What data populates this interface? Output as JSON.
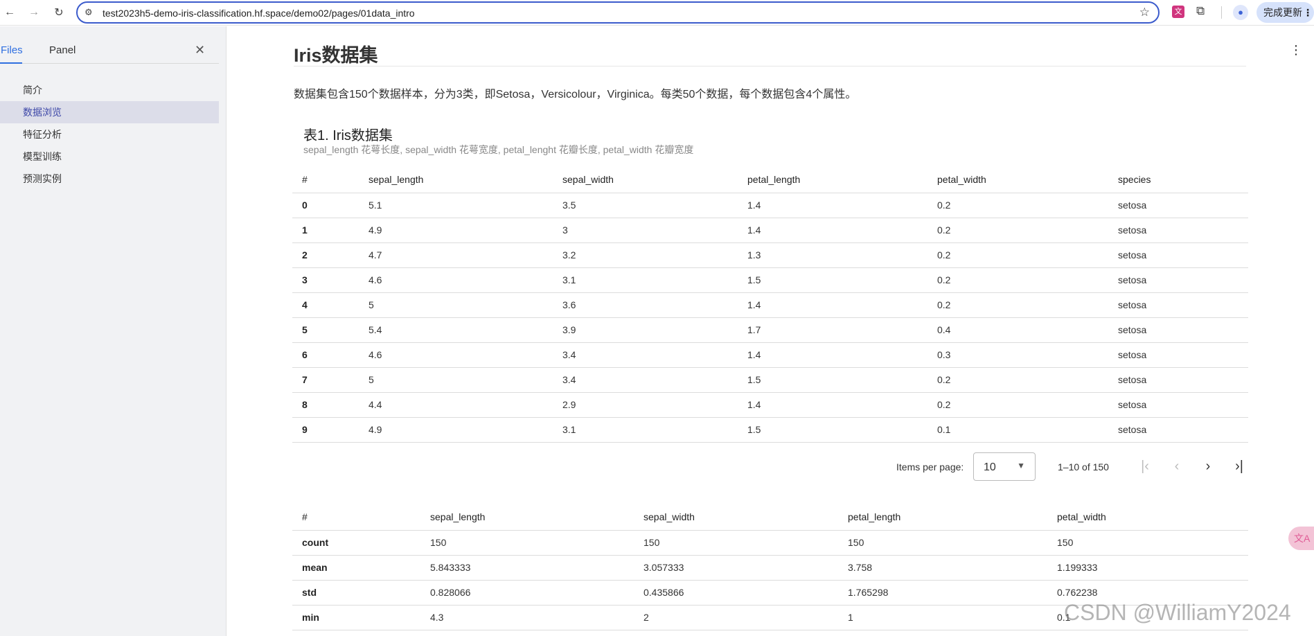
{
  "browser": {
    "url": "test2023h5-demo-iris-classification.hf.space/demo02/pages/01data_intro",
    "ext_label": "文",
    "update_button": "完成更新"
  },
  "sidebar": {
    "tabs": [
      {
        "label": "Files"
      },
      {
        "label": "Panel"
      }
    ],
    "items": [
      {
        "label": "简介"
      },
      {
        "label": "数据浏览"
      },
      {
        "label": "特征分析"
      },
      {
        "label": "模型训练"
      },
      {
        "label": "预测实例"
      }
    ]
  },
  "main": {
    "title": "Iris数据集",
    "intro": "数据集包含150个数据样本，分为3类，即Setosa，Versicolour，Virginica。每类50个数据，每个数据包含4个属性。",
    "caption": "表1. Iris数据集",
    "subcaption": "sepal_length 花萼长度, sepal_width 花萼宽度, petal_lenght 花瓣长度, petal_width 花瓣宽度",
    "table1": {
      "headers": [
        "#",
        "sepal_length",
        "sepal_width",
        "petal_length",
        "petal_width",
        "species"
      ],
      "rows": [
        [
          "0",
          "5.1",
          "3.5",
          "1.4",
          "0.2",
          "setosa"
        ],
        [
          "1",
          "4.9",
          "3",
          "1.4",
          "0.2",
          "setosa"
        ],
        [
          "2",
          "4.7",
          "3.2",
          "1.3",
          "0.2",
          "setosa"
        ],
        [
          "3",
          "4.6",
          "3.1",
          "1.5",
          "0.2",
          "setosa"
        ],
        [
          "4",
          "5",
          "3.6",
          "1.4",
          "0.2",
          "setosa"
        ],
        [
          "5",
          "5.4",
          "3.9",
          "1.7",
          "0.4",
          "setosa"
        ],
        [
          "6",
          "4.6",
          "3.4",
          "1.4",
          "0.3",
          "setosa"
        ],
        [
          "7",
          "5",
          "3.4",
          "1.5",
          "0.2",
          "setosa"
        ],
        [
          "8",
          "4.4",
          "2.9",
          "1.4",
          "0.2",
          "setosa"
        ],
        [
          "9",
          "4.9",
          "3.1",
          "1.5",
          "0.1",
          "setosa"
        ]
      ]
    },
    "paginator": {
      "items_per_page_label": "Items per page:",
      "items_per_page_value": "10",
      "range": "1–10 of 150"
    },
    "table2": {
      "headers": [
        "#",
        "sepal_length",
        "sepal_width",
        "petal_length",
        "petal_width"
      ],
      "rows": [
        [
          "count",
          "150",
          "150",
          "150",
          "150"
        ],
        [
          "mean",
          "5.843333",
          "3.057333",
          "3.758",
          "1.199333"
        ],
        [
          "std",
          "0.828066",
          "0.435866",
          "1.765298",
          "0.762238"
        ],
        [
          "min",
          "4.3",
          "2",
          "1",
          "0.1"
        ]
      ]
    }
  },
  "float_button": "文A",
  "watermark": "CSDN @WilliamY2024"
}
